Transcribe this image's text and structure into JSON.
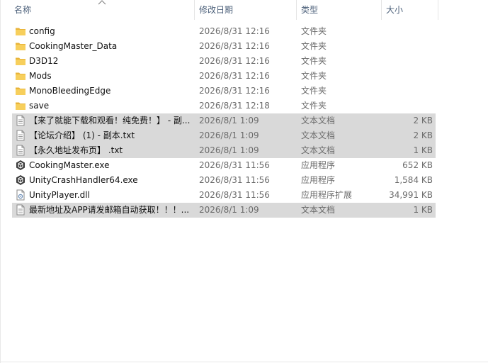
{
  "header": {
    "name": "名称",
    "date": "修改日期",
    "type": "类型",
    "size": "大小"
  },
  "files": [
    {
      "name": "config",
      "date": "2026/8/31 12:16",
      "type": "文件夹",
      "size": "",
      "icon": "folder-icon",
      "selected": false
    },
    {
      "name": "CookingMaster_Data",
      "date": "2026/8/31 12:16",
      "type": "文件夹",
      "size": "",
      "icon": "folder-icon",
      "selected": false
    },
    {
      "name": "D3D12",
      "date": "2026/8/31 12:16",
      "type": "文件夹",
      "size": "",
      "icon": "folder-icon",
      "selected": false
    },
    {
      "name": "Mods",
      "date": "2026/8/31 12:16",
      "type": "文件夹",
      "size": "",
      "icon": "folder-icon",
      "selected": false
    },
    {
      "name": "MonoBleedingEdge",
      "date": "2026/8/31 12:16",
      "type": "文件夹",
      "size": "",
      "icon": "folder-icon",
      "selected": false
    },
    {
      "name": "save",
      "date": "2026/8/31 12:18",
      "type": "文件夹",
      "size": "",
      "icon": "folder-icon",
      "selected": false
    },
    {
      "name": "【来了就能下载和观看！纯免费！】 - 副...",
      "date": "2026/8/1 1:09",
      "type": "文本文档",
      "size": "2 KB",
      "icon": "text-file-icon",
      "selected": true
    },
    {
      "name": "【论坛介绍】 (1) - 副本.txt",
      "date": "2026/8/1 1:09",
      "type": "文本文档",
      "size": "2 KB",
      "icon": "text-file-icon",
      "selected": true
    },
    {
      "name": "【永久地址发布页】 .txt",
      "date": "2026/8/1 1:09",
      "type": "文本文档",
      "size": "1 KB",
      "icon": "text-file-icon",
      "selected": true
    },
    {
      "name": "CookingMaster.exe",
      "date": "2026/8/31 11:56",
      "type": "应用程序",
      "size": "652 KB",
      "icon": "unity-app-icon",
      "selected": false
    },
    {
      "name": "UnityCrashHandler64.exe",
      "date": "2026/8/31 11:56",
      "type": "应用程序",
      "size": "1,584 KB",
      "icon": "unity-app-icon",
      "selected": false
    },
    {
      "name": "UnityPlayer.dll",
      "date": "2026/8/31 11:56",
      "type": "应用程序扩展",
      "size": "34,991 KB",
      "icon": "dll-file-icon",
      "selected": false
    },
    {
      "name": "最新地址及APP请发邮箱自动获取！！！...",
      "date": "2026/8/1 1:09",
      "type": "文本文档",
      "size": "1 KB",
      "icon": "text-file-icon",
      "selected": true
    }
  ]
}
